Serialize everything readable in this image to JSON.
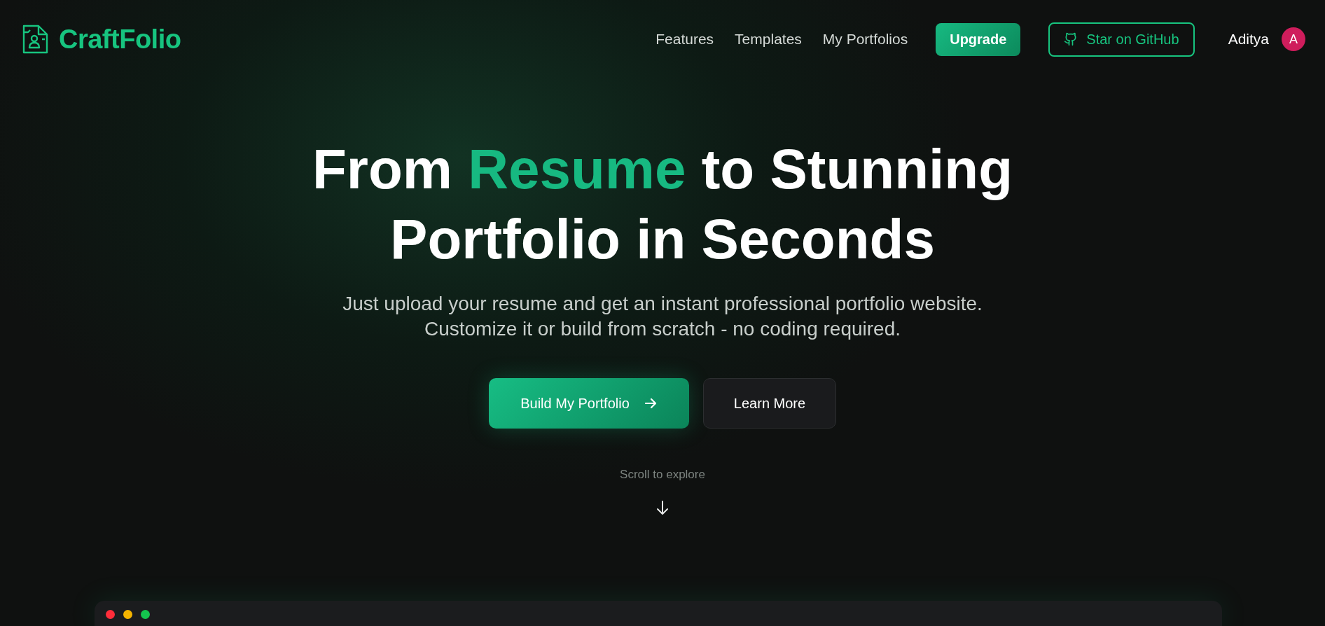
{
  "brand": {
    "name": "CraftFolio"
  },
  "nav": {
    "links": [
      "Features",
      "Templates",
      "My Portfolios"
    ],
    "upgrade": "Upgrade",
    "github": "Star on GitHub",
    "user": {
      "name": "Aditya",
      "initial": "A"
    }
  },
  "hero": {
    "headline": {
      "before": "From ",
      "accent": "Resume",
      "after": " to Stunning Portfolio in Seconds"
    },
    "subtitle": "Just upload your resume and get an instant professional portfolio website. Customize it or build from scratch - no coding required.",
    "primary_button": "Build My Portfolio",
    "secondary_button": "Learn More",
    "scroll_hint": "Scroll to explore"
  },
  "preview_window": {
    "dots": [
      {
        "color": "#ff2d3a"
      },
      {
        "color": "#f5b400"
      },
      {
        "color": "#14c44e"
      }
    ]
  }
}
